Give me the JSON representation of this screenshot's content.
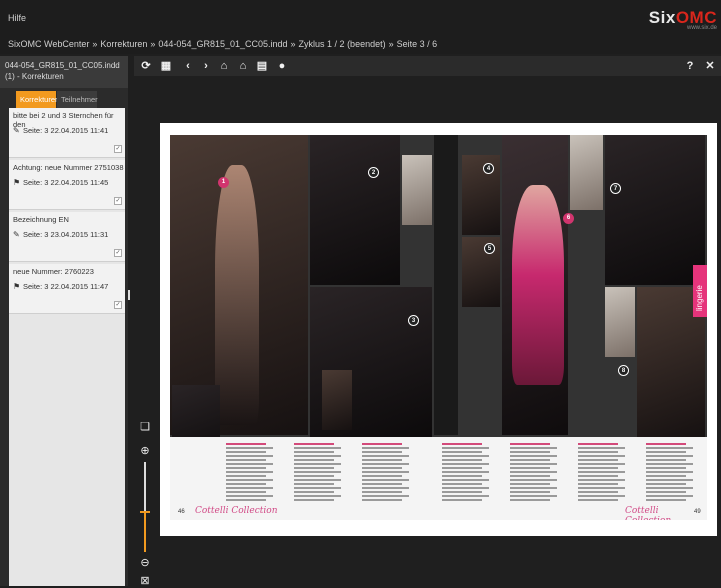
{
  "header": {
    "help_label": "Hilfe",
    "logo_part1": "Six",
    "logo_part2": "OMC",
    "logo_url": "www.six.de"
  },
  "breadcrumb": [
    "SixOMC WebCenter",
    "Korrekturen",
    "044-054_GR815_01_CC05.indd",
    "Zyklus 1 / 2 (beendet)",
    "Seite 3 / 6"
  ],
  "breadcrumb_sep": "»",
  "sidebar": {
    "doc_title": "044-054_GR815_01_CC05.indd (1) - Korrekturen",
    "tabs": [
      {
        "label": "Korrekturen"
      },
      {
        "label": "Teilnehmer"
      }
    ],
    "comments": [
      {
        "text": "bitte bei 2 und 3 Sternchen für den",
        "meta": "Seite: 3   22.04.2015 11:41",
        "icon": "brush-icon",
        "glyph": "✎"
      },
      {
        "text": "Achtung: neue Nummer 2751038",
        "meta": "Seite: 3   22.04.2015 11:45",
        "icon": "flag-icon",
        "glyph": "⚑"
      },
      {
        "text": "Bezeichnung EN",
        "meta": "Seite: 3   23.04.2015 11:31",
        "icon": "pen-icon",
        "glyph": "✎"
      },
      {
        "text": "neue Nummer: 2760223",
        "meta": "Seite: 3   22.04.2015 11:47",
        "icon": "flag-icon",
        "glyph": "⚑"
      }
    ],
    "check_glyph": "✓"
  },
  "toolbar": {
    "icons": [
      {
        "name": "refresh-icon",
        "glyph": "⟳"
      },
      {
        "name": "grid-icon",
        "glyph": "▦"
      },
      {
        "name": "prev-page-icon",
        "glyph": "‹"
      },
      {
        "name": "next-page-icon",
        "glyph": "›"
      },
      {
        "name": "stamp-approve-icon",
        "glyph": "⌂"
      },
      {
        "name": "stamp-reject-icon",
        "glyph": "⌂"
      },
      {
        "name": "document-icon",
        "glyph": "▤"
      },
      {
        "name": "drop-icon",
        "glyph": "●"
      }
    ],
    "help_glyph": "?",
    "close_glyph": "✕"
  },
  "zoom": {
    "level": 0.45,
    "plus_glyph": "⊕",
    "minus_glyph": "⊖",
    "fit_glyph": "⊠",
    "page_glyph": "❏"
  },
  "spread": {
    "left_page_num": "46",
    "right_page_num": "49",
    "brand_left": "Cottelli Collection",
    "brand_right": "Cottelli Collection",
    "lingerie_label": "lingerie",
    "badges": [
      "1",
      "2",
      "3",
      "4",
      "5",
      "6",
      "7",
      "8"
    ],
    "colors": {
      "accent": "#f29a1f",
      "brand": "#d14a86",
      "tab_bg": "#e5347b"
    }
  }
}
